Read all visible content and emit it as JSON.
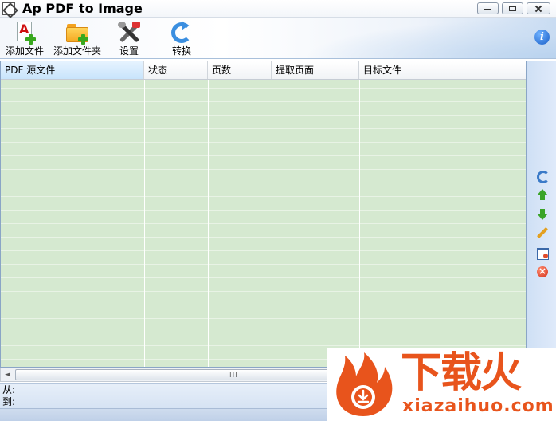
{
  "window": {
    "title": "Ap PDF to Image"
  },
  "toolbar": {
    "items": [
      {
        "label": "添加文件",
        "icon": "pdf-add-icon"
      },
      {
        "label": "添加文件夹",
        "icon": "folder-add-icon"
      },
      {
        "label": "设置",
        "icon": "settings-icon"
      },
      {
        "label": "转换",
        "icon": "convert-icon"
      }
    ],
    "info_glyph": "i"
  },
  "file_list": {
    "columns": [
      {
        "label": "PDF 源文件"
      },
      {
        "label": "状态"
      },
      {
        "label": "页数"
      },
      {
        "label": "提取页面"
      },
      {
        "label": "目标文件"
      }
    ],
    "rows": []
  },
  "side_actions": [
    "refresh-icon",
    "move-up-icon",
    "move-down-icon",
    "edit-icon",
    "window-icon",
    "delete-icon"
  ],
  "scrollbar": {
    "left_arrow": "◄",
    "grip": "III"
  },
  "bottom": {
    "from_label": "从:",
    "from_value": "",
    "to_label": "到:",
    "to_value": ""
  },
  "watermark": {
    "brand": "下载火",
    "domain": "xiazaihuo.com"
  },
  "colors": {
    "row_fill": "#d5e9d0",
    "accent_orange": "#e8541c",
    "panel_blue": "#cfe0f5"
  }
}
